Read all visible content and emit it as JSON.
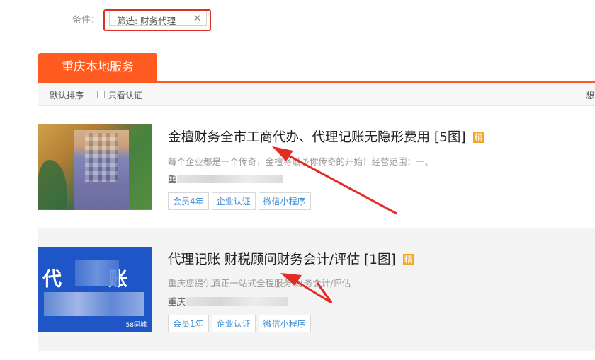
{
  "filter": {
    "label": "条件：",
    "tag_text": "筛选: 财务代理",
    "remove_symbol": "×"
  },
  "tab": {
    "label": "重庆本地服务"
  },
  "sortbar": {
    "default_sort": "默认排序",
    "verified_only": "只看认证",
    "right_text": "想"
  },
  "listings": [
    {
      "title": "金檀财务全市工商代办、代理记账无隐形费用 [5图]",
      "badge": "精",
      "description": "每个企业都是一个传奇，金檀将赋予你传奇的开始！经营范围：一、",
      "address_prefix": "重",
      "tags": [
        "会员4年",
        "企业认证",
        "微信小程序"
      ]
    },
    {
      "title": "代理记账 财税顾问财务会计/评估 [1图]",
      "badge": "精",
      "description": "重庆您提供真正一站式全程服务;财务会计/评估",
      "address_prefix": "重庆",
      "tags": [
        "会员1年",
        "企业认证",
        "微信小程序"
      ],
      "thumb_text_left": "代",
      "thumb_text_right": "账",
      "thumb_logo": "58同城"
    }
  ],
  "colors": {
    "accent": "#ff5a1f",
    "annotation": "#e02e24",
    "tag_text": "#3b8bd6",
    "badge": "#f5a623"
  }
}
